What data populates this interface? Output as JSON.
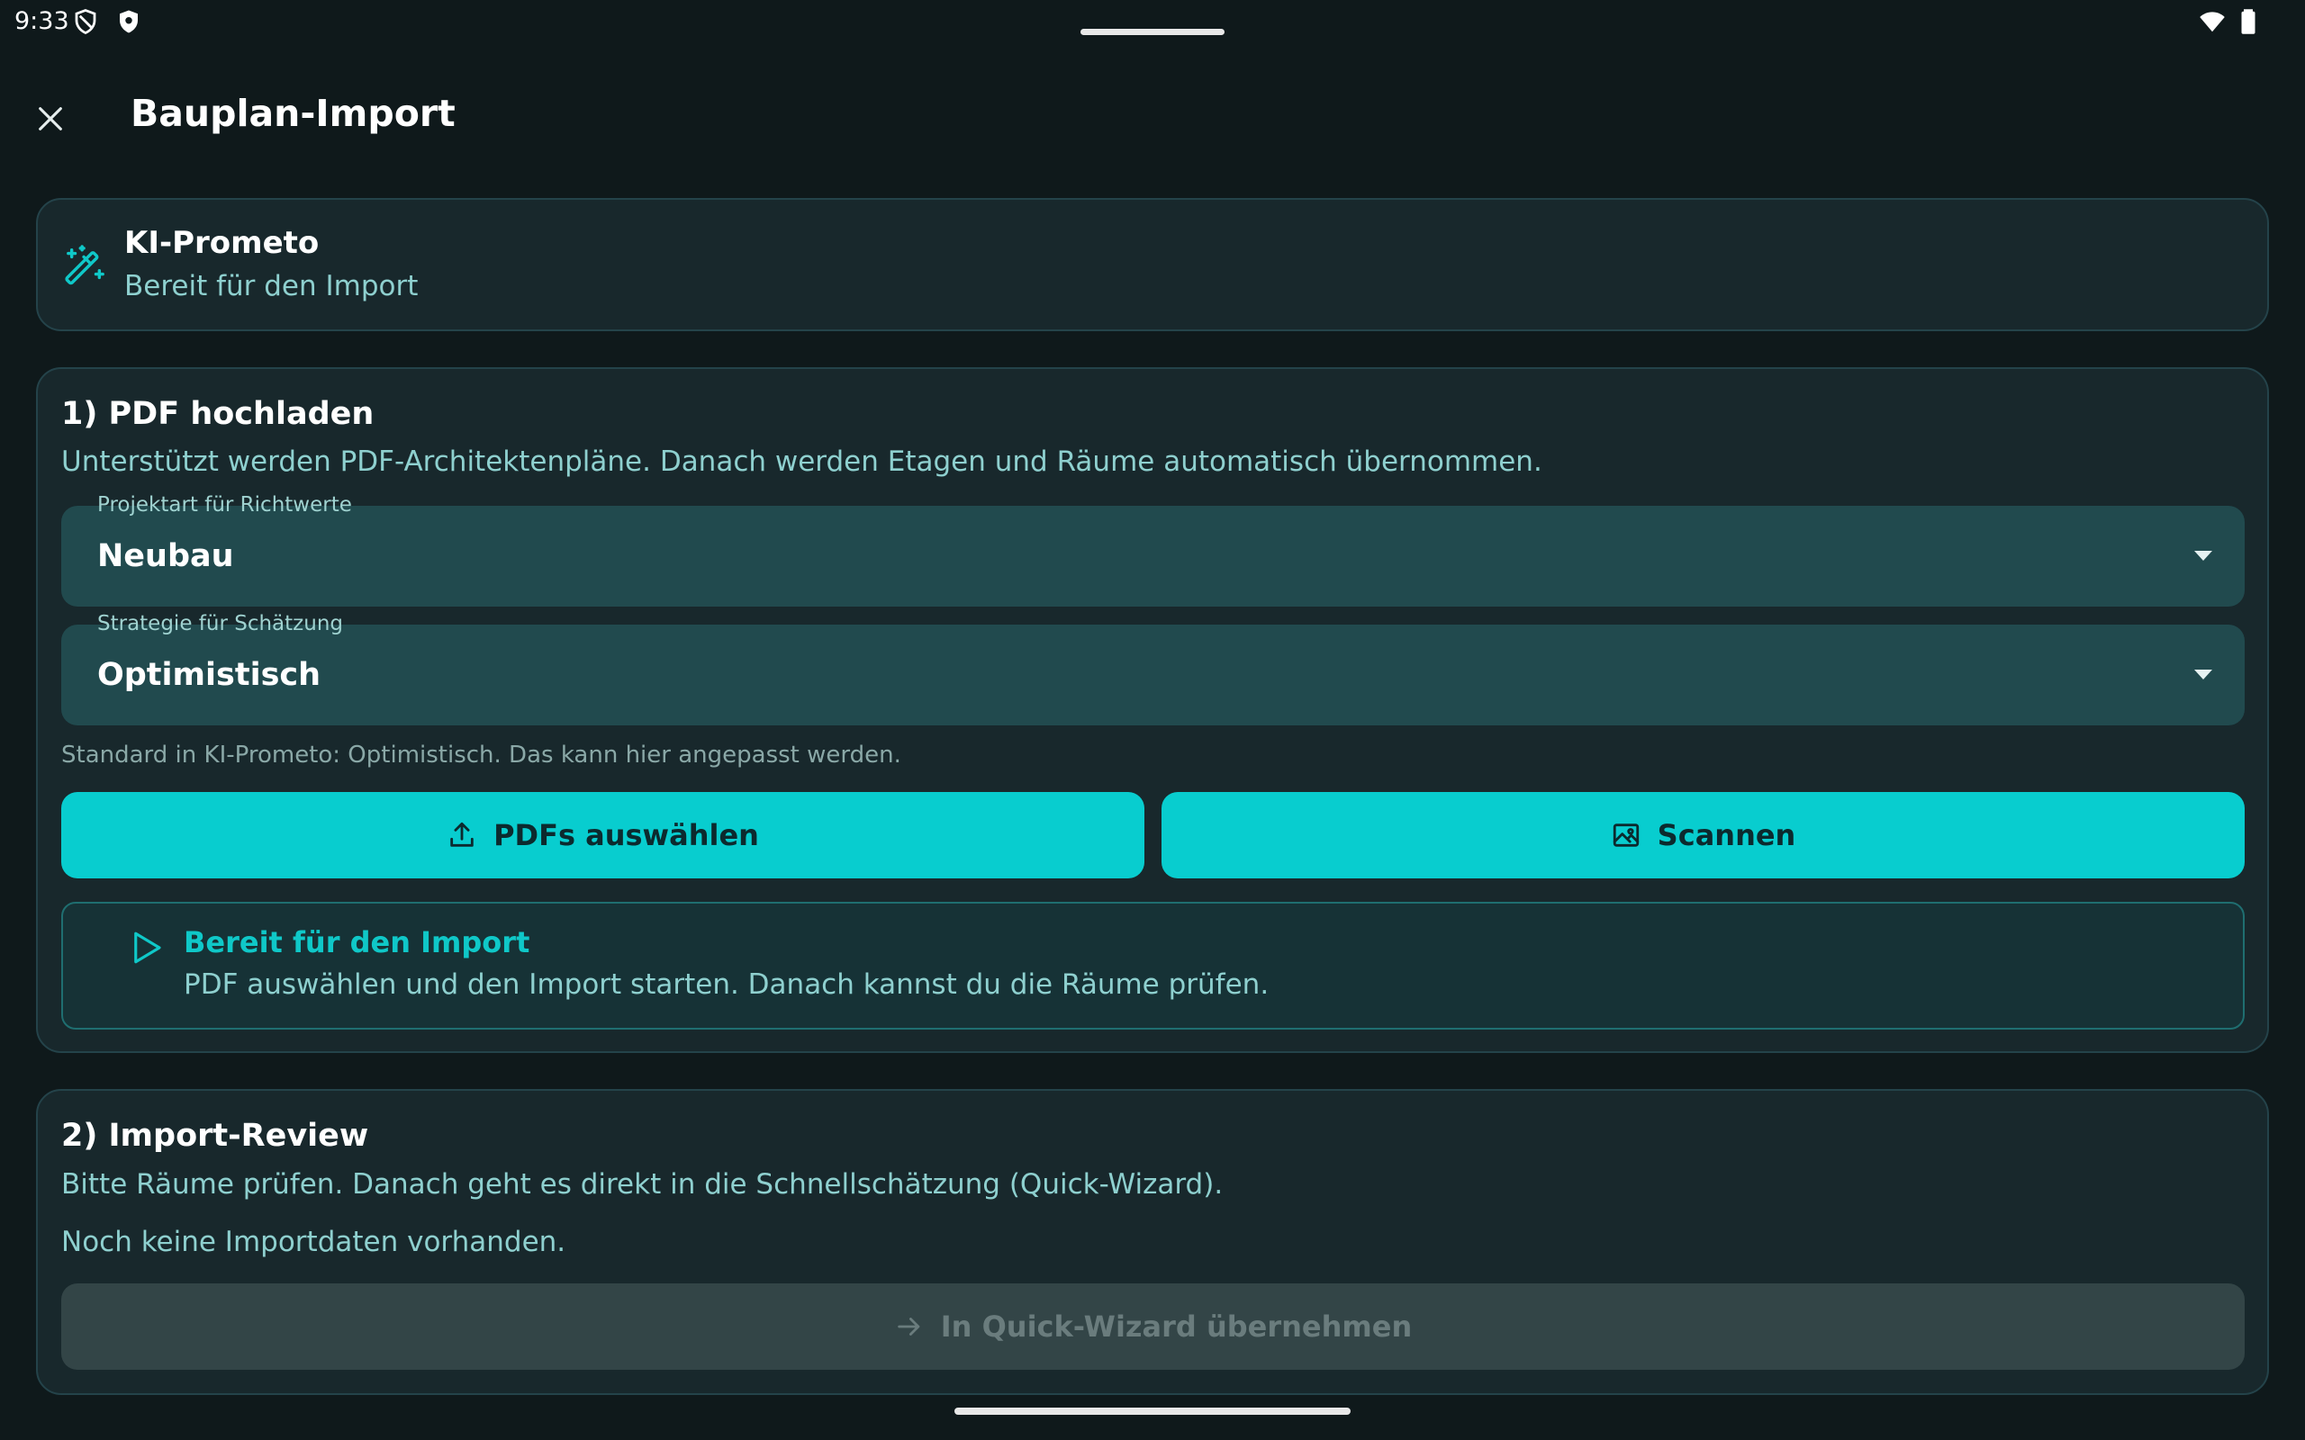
{
  "status_bar": {
    "time": "9:33",
    "icons": [
      "shield-outline-icon",
      "shield-badge-icon",
      "wifi-icon",
      "battery-icon"
    ]
  },
  "app_bar": {
    "title": "Bauplan-Import",
    "close_icon": "close-icon"
  },
  "status_card": {
    "title": "KI-Prometo",
    "subtitle": "Bereit für den Import",
    "icon": "magic-wand-icon"
  },
  "upload_section": {
    "title": "1) PDF hochladen",
    "description": "Unterstützt werden PDF-Architektenpläne. Danach werden Etagen und Räume automatisch übernommen.",
    "project_type": {
      "label": "Projektart für Richtwerte",
      "value": "Neubau"
    },
    "strategy": {
      "label": "Strategie für Schätzung",
      "value": "Optimistisch"
    },
    "hint": "Standard in KI-Prometo: Optimistisch. Das kann hier angepasst werden.",
    "select_pdfs_label": "PDFs auswählen",
    "scan_label": "Scannen",
    "info": {
      "title": "Bereit für den Import",
      "description": "PDF auswählen und den Import starten. Danach kannst du die Räume prüfen."
    }
  },
  "review_section": {
    "title": "2) Import-Review",
    "description": "Bitte Räume prüfen. Danach geht es direkt in die Schnellschätzung (Quick-Wizard).",
    "empty_text": "Noch keine Importdaten vorhanden.",
    "apply_label": "In Quick-Wizard übernehmen"
  },
  "colors": {
    "background": "#0f191b",
    "card": "#18282c",
    "accent": "#08cdcf",
    "muted_text": "#8ed0cf"
  }
}
